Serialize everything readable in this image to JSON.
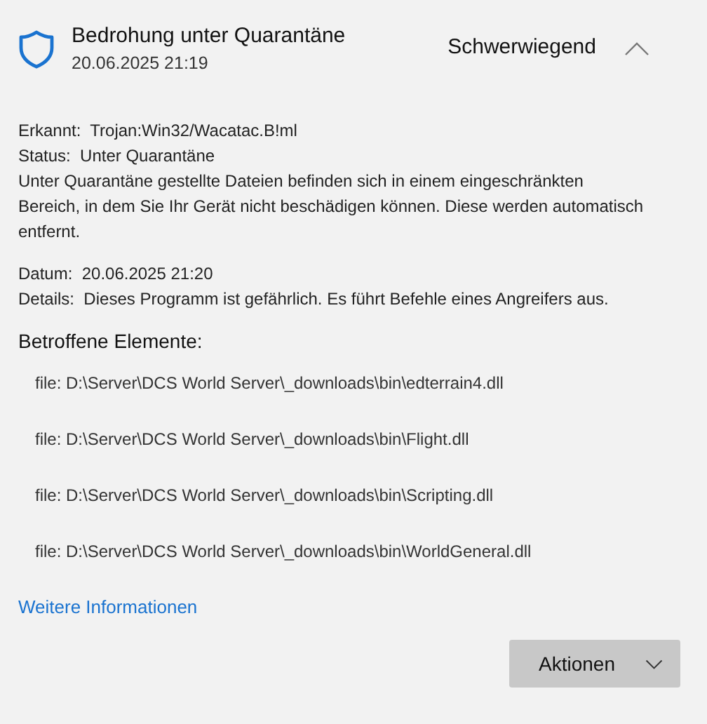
{
  "header": {
    "title": "Bedrohung unter Quarantäne",
    "date": "20.06.2025 21:19",
    "severity": "Schwerwiegend",
    "expanded": true
  },
  "info_top": [
    {
      "label": "Erkannt:",
      "value": "Trojan:Win32/Wacatac.B!ml"
    },
    {
      "label": "Status:",
      "value": "Unter Quarantäne"
    }
  ],
  "description": "Unter Quarantäne gestellte Dateien befinden sich in einem eingeschränkten Bereich, in dem Sie Ihr Gerät nicht beschädigen können. Diese werden automatisch entfernt.",
  "info_bottom": [
    {
      "label": "Datum:",
      "value": "20.06.2025 21:20"
    },
    {
      "label": "Details:",
      "value": "Dieses Programm ist gefährlich. Es führt Befehle eines Angreifers aus."
    }
  ],
  "affected_heading": "Betroffene Elemente:",
  "affected_items": [
    "file: D:\\Server\\DCS World Server\\_downloads\\bin\\edterrain4.dll",
    "file: D:\\Server\\DCS World Server\\_downloads\\bin\\Flight.dll",
    "file: D:\\Server\\DCS World Server\\_downloads\\bin\\Scripting.dll",
    "file: D:\\Server\\DCS World Server\\_downloads\\bin\\WorldGeneral.dll"
  ],
  "more_link": "Weitere Informationen",
  "actions_button": "Aktionen"
}
